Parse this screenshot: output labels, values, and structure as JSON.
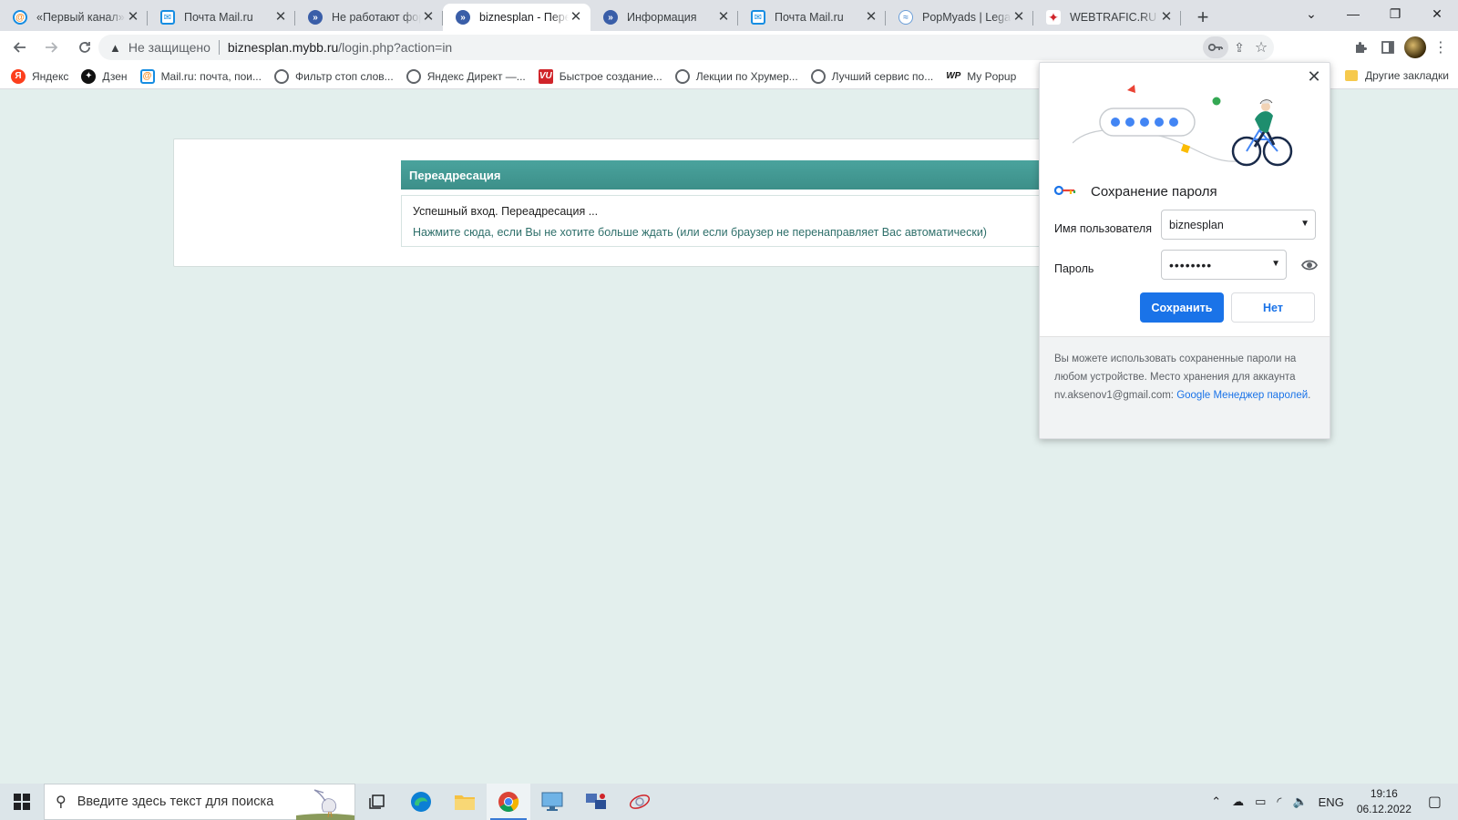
{
  "tabs": [
    {
      "title": "«Первый канал» в",
      "favicon": "mailru-at-icon",
      "active": false
    },
    {
      "title": "Почта Mail.ru",
      "favicon": "mailru-mail-icon",
      "active": false
    },
    {
      "title": "Не работают фору",
      "favicon": "mybb-icon",
      "active": false
    },
    {
      "title": "biznesplan - Переа",
      "favicon": "mybb-icon",
      "active": true
    },
    {
      "title": "Информация",
      "favicon": "mybb-icon",
      "active": false
    },
    {
      "title": "Почта Mail.ru",
      "favicon": "mailru-mail-icon",
      "active": false
    },
    {
      "title": "PopMyads | Legacy",
      "favicon": "popmyads-icon",
      "active": false
    },
    {
      "title": "WEBTRAFIC.RU | Ак",
      "favicon": "webtrafic-icon",
      "active": false
    }
  ],
  "address_bar": {
    "security_label": "Не защищено",
    "url_host": "biznesplan.mybb.ru",
    "url_path": "/login.php?action=in"
  },
  "bookmarks": [
    {
      "label": "Яндекс",
      "icon": "yandex-icon"
    },
    {
      "label": "Дзен",
      "icon": "dzen-icon"
    },
    {
      "label": "Mail.ru: почта, пои...",
      "icon": "mailru-icon"
    },
    {
      "label": "Фильтр стоп слов...",
      "icon": "globe-icon"
    },
    {
      "label": "Яндекс Директ —...",
      "icon": "globe-icon"
    },
    {
      "label": "Быстрое создание...",
      "icon": "vu-icon"
    },
    {
      "label": "Лекции по Хрумер...",
      "icon": "globe-icon"
    },
    {
      "label": "Лучший сервис по...",
      "icon": "globe-icon"
    },
    {
      "label": "My Popup",
      "icon": "wp-icon"
    }
  ],
  "other_bookmarks": "Другие закладки",
  "page": {
    "header": "Переадресация",
    "message": "Успешный вход. Переадресация ...",
    "link": "Нажмите сюда, если Вы не хотите больше ждать (или если браузер не перенаправляет Вас автоматически)"
  },
  "password_popup": {
    "title": "Сохранение пароля",
    "username_label": "Имя пользователя",
    "username_value": "biznesplan",
    "password_label": "Пароль",
    "password_value": "••••••••",
    "save_button": "Сохранить",
    "no_button": "Нет",
    "footer_text": "Вы можете использовать сохраненные пароли на любом устройстве. Место хранения для аккаунта nv.aksenov1@gmail.com: ",
    "footer_link": "Google Менеджер паролей",
    "footer_end": "."
  },
  "taskbar": {
    "search_placeholder": "Введите здесь текст для поиска",
    "language": "ENG",
    "time": "19:16",
    "date": "06.12.2022"
  },
  "colors": {
    "accent": "#1a73e8",
    "page_background": "#e3efed",
    "header_teal": "#3c8f89"
  }
}
